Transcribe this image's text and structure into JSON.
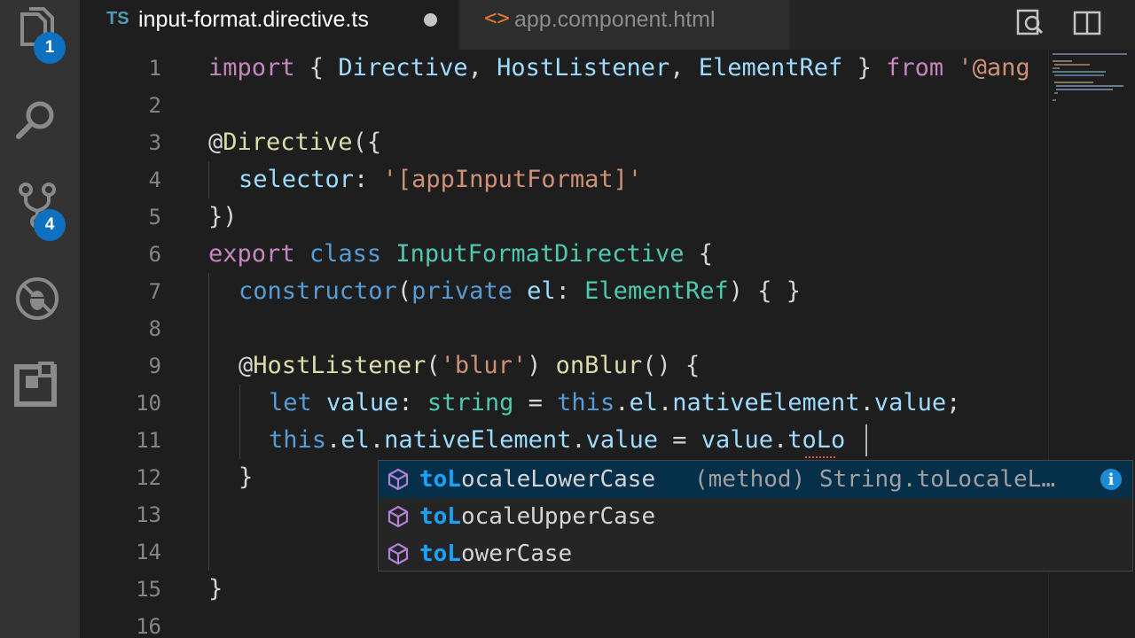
{
  "activity_bar": {
    "explorer_badge": "1",
    "scm_badge": "4"
  },
  "tabs": [
    {
      "type": "TS",
      "label": "input-format.directive.ts",
      "active": true,
      "modified": true
    },
    {
      "type": "<>",
      "label": "app.component.html",
      "active": false
    }
  ],
  "editor": {
    "line_numbers": [
      "1",
      "2",
      "3",
      "4",
      "5",
      "6",
      "7",
      "8",
      "9",
      "10",
      "11",
      "12",
      "13",
      "14",
      "15",
      "16"
    ],
    "lines": {
      "l1": {
        "t1": "import",
        "t2": " { ",
        "t3": "Directive",
        "t4": ", ",
        "t5": "HostListener",
        "t6": ", ",
        "t7": "ElementRef",
        "t8": " } ",
        "t9": "from",
        "t10": " '@ang"
      },
      "l3": {
        "t1": "@",
        "t2": "Directive",
        "t3": "({"
      },
      "l4": {
        "t1": "selector",
        "t2": ": ",
        "t3": "'[appInputFormat]'"
      },
      "l5": {
        "t1": "})"
      },
      "l6": {
        "t1": "export",
        "t2": " ",
        "t3": "class",
        "t4": " ",
        "t5": "InputFormatDirective",
        "t6": " {"
      },
      "l7": {
        "t1": "constructor",
        "t2": "(",
        "t3": "private",
        "t4": " ",
        "t5": "el",
        "t6": ": ",
        "t7": "ElementRef",
        "t8": ") { }"
      },
      "l9": {
        "t1": "@",
        "t2": "HostListener",
        "t3": "(",
        "t4": "'blur'",
        "t5": ") ",
        "t6": "onBlur",
        "t7": "() {"
      },
      "l10": {
        "t1": "let",
        "t2": " ",
        "t3": "value",
        "t4": ": ",
        "t5": "string",
        "t6": " = ",
        "t7": "this",
        "t8": ".",
        "t9": "el",
        "t10": ".",
        "t11": "nativeElement",
        "t12": ".",
        "t13": "value",
        "t14": ";"
      },
      "l11": {
        "t1": "this",
        "t2": ".",
        "t3": "el",
        "t4": ".",
        "t5": "nativeElement",
        "t6": ".",
        "t7": "value",
        "t8": " = ",
        "t9": "value",
        "t10": ".",
        "t11": "toLo"
      },
      "l12": {
        "t1": "}"
      },
      "l15": {
        "t1": "}"
      }
    }
  },
  "suggestions": [
    {
      "match": "toL",
      "rest": "ocaleLowerCase",
      "detail": "(method) String.toLocaleL…",
      "selected": true
    },
    {
      "match": "toL",
      "rest": "ocaleUpperCase",
      "detail": "",
      "selected": false
    },
    {
      "match": "toL",
      "rest": "owerCase",
      "detail": "",
      "selected": false
    }
  ],
  "colors": {
    "activity_bar": "#333333",
    "badge": "#0e70c0",
    "editor_bg": "#1e1e1e",
    "suggest_selected": "#062f4a",
    "match_highlight": "#18a3ff"
  }
}
